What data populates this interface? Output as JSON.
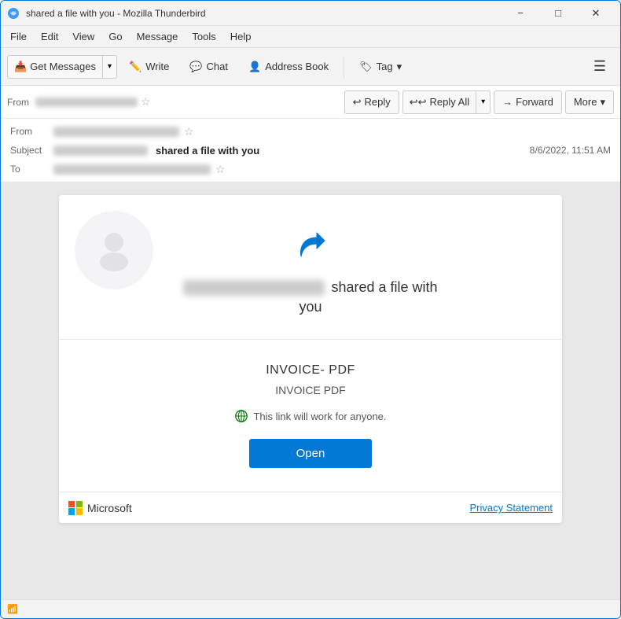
{
  "window": {
    "title": "shared a file with you - Mozilla Thunderbird",
    "icon": "thunderbird"
  },
  "titlebar": {
    "minimize_label": "−",
    "maximize_label": "□",
    "close_label": "✕"
  },
  "menubar": {
    "items": [
      {
        "id": "file",
        "label": "File"
      },
      {
        "id": "edit",
        "label": "Edit"
      },
      {
        "id": "view",
        "label": "View"
      },
      {
        "id": "go",
        "label": "Go"
      },
      {
        "id": "message",
        "label": "Message"
      },
      {
        "id": "tools",
        "label": "Tools"
      },
      {
        "id": "help",
        "label": "Help"
      }
    ]
  },
  "toolbar": {
    "get_messages_label": "Get Messages",
    "write_label": "Write",
    "chat_label": "Chat",
    "address_book_label": "Address Book",
    "tag_label": "Tag"
  },
  "email_actions": {
    "reply_label": "Reply",
    "reply_all_label": "Reply All",
    "forward_label": "Forward",
    "more_label": "More"
  },
  "email_meta": {
    "from_label": "From",
    "subject_label": "Subject",
    "to_label": "To",
    "subject_text": "shared a file with you",
    "date_text": "8/6/2022, 11:51 AM"
  },
  "email_body": {
    "share_icon_label": "share icon",
    "sender_blurred": true,
    "message_part1": "shared a file with",
    "message_part2": "you",
    "invoice_title": "INVOICE- PDF",
    "invoice_subtitle": "INVOICE PDF",
    "link_notice": "This link will work for anyone.",
    "open_button_label": "Open",
    "microsoft_label": "Microsoft",
    "privacy_label": "Privacy Statement"
  },
  "statusbar": {
    "icon": "wifi-icon",
    "text": ""
  },
  "colors": {
    "accent": "#0078d4",
    "success": "#107c10",
    "window_border": "#0078d4"
  }
}
